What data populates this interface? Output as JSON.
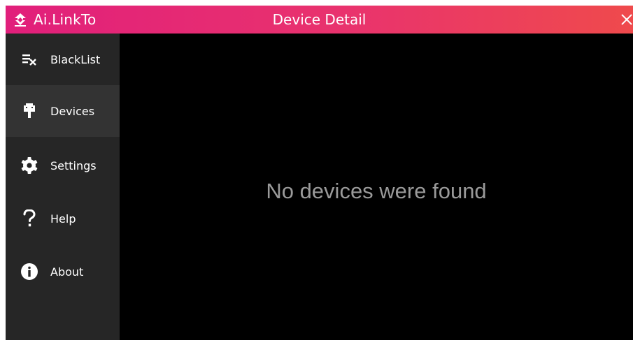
{
  "app": {
    "brand_name": "Ai.LinkTo",
    "window_title": "Device Detail",
    "brand_icon": "ai-linkto-logo-icon",
    "close_icon": "close-icon"
  },
  "colors": {
    "titlebar_gradient_start": "#e11f7b",
    "titlebar_gradient_end": "#ef4a4c",
    "sidebar_bg": "#262626",
    "sidebar_selected_bg": "#333333",
    "content_bg": "#000000",
    "empty_text": "#9a9a9a"
  },
  "sidebar": {
    "items": [
      {
        "label": "BlackList",
        "icon": "blacklist-icon",
        "selected": false
      },
      {
        "label": "Devices",
        "icon": "usb-plug-icon",
        "selected": true
      },
      {
        "label": "Settings",
        "icon": "gear-icon",
        "selected": false
      },
      {
        "label": "Help",
        "icon": "question-mark-icon",
        "selected": false
      },
      {
        "label": "About",
        "icon": "info-icon",
        "selected": false
      }
    ]
  },
  "main": {
    "empty_message": "No devices were found"
  }
}
